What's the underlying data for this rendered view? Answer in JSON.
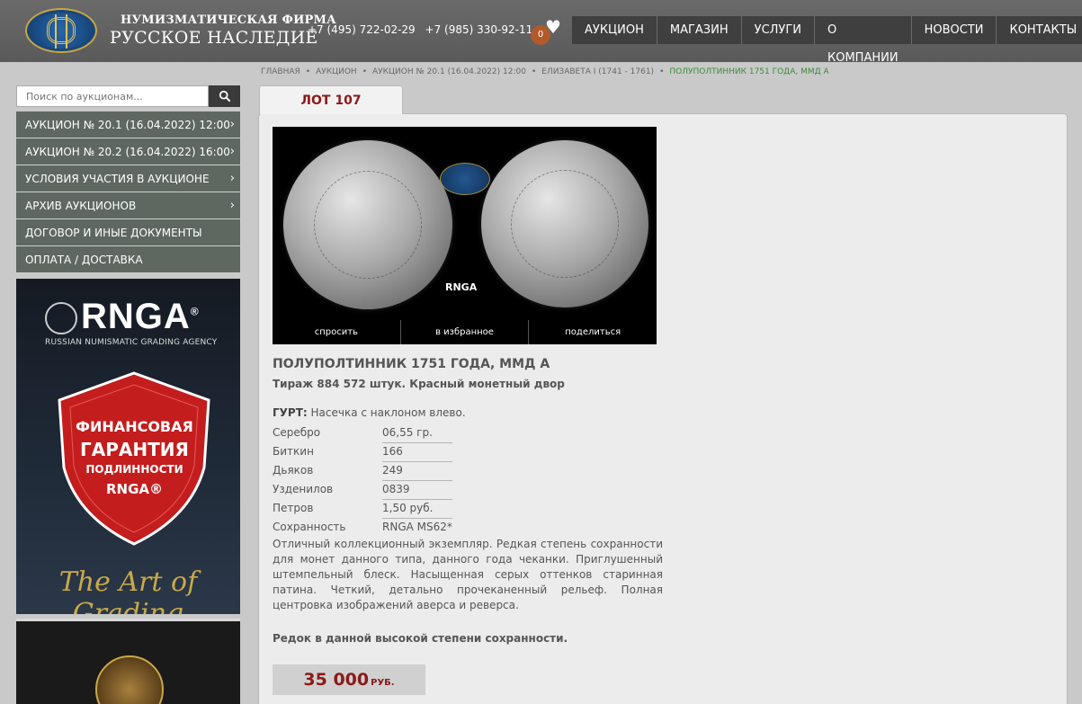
{
  "header": {
    "brand_top": "НУМИЗМАТИЧЕСКАЯ ФИРМА",
    "brand_main": "РУССКОЕ НАСЛЕДИЕ",
    "phones": [
      "+7 (495) 722-02-29",
      "+7 (985) 330-92-11"
    ],
    "favorites_count": "0",
    "nav": [
      "АУКЦИОН",
      "МАГАЗИН",
      "УСЛУГИ",
      "О КОМПАНИИ",
      "НОВОСТИ",
      "КОНТАКТЫ"
    ]
  },
  "breadcrumb": [
    "ГЛАВНАЯ",
    "АУКЦИОН",
    "АУКЦИОН № 20.1 (16.04.2022) 12:00",
    "ЕЛИЗАВЕТА I (1741 - 1761)",
    "ПОЛУПОЛТИННИК 1751 ГОДА, ММД А"
  ],
  "sidebar": {
    "search_placeholder": "Поиск по аукционам...",
    "menu": [
      {
        "label": "АУКЦИОН № 20.1 (16.04.2022) 12:00",
        "chevron": "›"
      },
      {
        "label": "АУКЦИОН № 20.2 (16.04.2022) 16:00",
        "chevron": "›"
      },
      {
        "label": "УСЛОВИЯ УЧАСТИЯ В АУКЦИОНЕ",
        "chevron": "›"
      },
      {
        "label": "АРХИВ АУКЦИОНОВ",
        "chevron": "›"
      },
      {
        "label": "ДОГОВОР И ИНЫЕ ДОКУМЕНТЫ",
        "chevron": ""
      },
      {
        "label": "ОПЛАТА / ДОСТАВКА",
        "chevron": ""
      }
    ],
    "banner": {
      "logo": "RNGA",
      "registered": "®",
      "subtitle": "RUSSIAN NUMISMATIC GRADING AGENCY",
      "shield_lines": [
        "ФИНАНСОВАЯ",
        "ГАРАНТИЯ",
        "ПОДЛИННОСТИ",
        "RNGA®"
      ],
      "slogan": "The Art of Grading"
    }
  },
  "lot": {
    "tab_label": "ЛОТ 107",
    "image_mark": "RNGA",
    "actions": [
      "спросить",
      "в избранное",
      "поделиться"
    ],
    "title": "ПОЛУПОЛТИННИК 1751 ГОДА, ММД А",
    "subtitle": "Тираж 884 572 штук. Красный монетный двор",
    "edge_label": "ГУРТ:",
    "edge_value": "Насечка с наклоном влево.",
    "specs": [
      {
        "key": "Серебро",
        "value": "06,55 гр."
      },
      {
        "key": "Биткин",
        "value": "166"
      },
      {
        "key": "Дьяков",
        "value": "249"
      },
      {
        "key": "Узденилов",
        "value": "0839"
      },
      {
        "key": "Петров",
        "value": "1,50 руб."
      },
      {
        "key": "Сохранность",
        "value": "RNGA MS62*"
      }
    ],
    "description": "Отличный коллекционный экземпляр. Редкая степень сохранности для монет данного типа, данного года чеканки. Приглушенный штемпельный блеск. Насыщенная серых оттенков старинная патина. Четкий, детально прочеканенный рельеф. Полная центровка изображений аверса и реверса.",
    "note": "Редок в данной высокой степени сохранности.",
    "price": "35 000",
    "currency": "РУБ."
  },
  "colors": {
    "header_bg": "#5f5f5f",
    "nav_bg": "#3f3f3f",
    "sidebar_item_bg": "#5f6761",
    "accent_red": "#8b1a1a",
    "breadcrumb_active": "#3a8a3a"
  },
  "icons": {
    "search": "search-icon",
    "favorites": "heart-icon",
    "chevron": "chevron-right-icon"
  }
}
